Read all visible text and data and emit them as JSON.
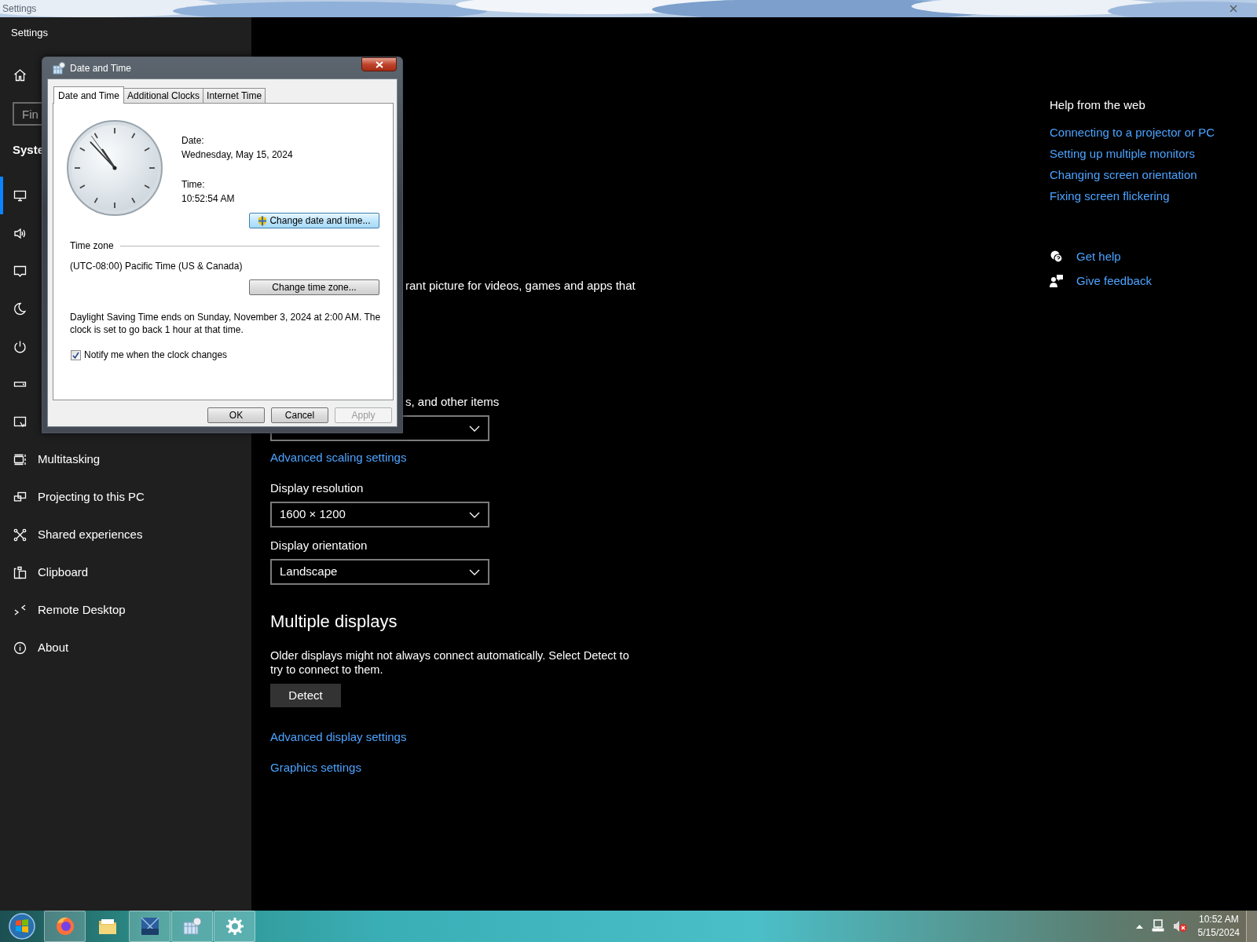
{
  "background_window": {
    "title": "Settings"
  },
  "settings": {
    "title": "Settings",
    "search": {
      "placeholder": "Fin"
    },
    "section": "Syste",
    "nav": [
      {
        "selected": true
      },
      {
        "selected": false
      },
      {
        "selected": false
      },
      {
        "selected": false
      },
      {
        "selected": false
      },
      {
        "selected": false
      },
      {
        "selected": false
      },
      {
        "label": "Multitasking",
        "selected": false
      },
      {
        "label": "Projecting to this PC",
        "selected": false
      },
      {
        "label": "Shared experiences",
        "selected": false
      },
      {
        "label": "Clipboard",
        "selected": false
      },
      {
        "label": "Remote Desktop",
        "selected": false
      },
      {
        "label": "About",
        "selected": false
      }
    ],
    "main": [
      {
        "kind": "fragment",
        "text": "rant picture for videos, games and apps that"
      },
      {
        "kind": "fragment",
        "text": "s, and other items"
      },
      {
        "kind": "dropdown"
      },
      {
        "kind": "link",
        "text": "Advanced scaling settings"
      },
      {
        "kind": "label",
        "text": "Display resolution"
      },
      {
        "kind": "dropdown",
        "value": "1600 × 1200"
      },
      {
        "kind": "label",
        "text": "Display orientation"
      },
      {
        "kind": "dropdown",
        "value": "Landscape"
      },
      {
        "kind": "heading",
        "text": "Multiple displays"
      },
      {
        "kind": "paragraph",
        "text": "Older displays might not always connect automatically. Select Detect to try to connect to them."
      },
      {
        "kind": "button",
        "text": "Detect"
      },
      {
        "kind": "link",
        "text": "Advanced display settings"
      },
      {
        "kind": "link",
        "text": "Graphics settings"
      }
    ],
    "help": {
      "title": "Help from the web",
      "links": [
        "Connecting to a projector or PC",
        "Setting up multiple monitors",
        "Changing screen orientation",
        "Fixing screen flickering"
      ],
      "actions": [
        {
          "label": "Get help"
        },
        {
          "label": "Give feedback"
        }
      ]
    }
  },
  "dialog": {
    "title": "Date and Time",
    "tabs": [
      {
        "label": "Date and Time",
        "selected": true
      },
      {
        "label": "Additional Clocks",
        "selected": false
      },
      {
        "label": "Internet Time",
        "selected": false
      }
    ],
    "date_label": "Date:",
    "date": "Wednesday, May 15, 2024",
    "time_label": "Time:",
    "time": "10:52:54 AM",
    "change_button": {
      "label": "Change date and time...",
      "highlighted": true
    },
    "time_zone_heading": "Time zone",
    "time_zone": "(UTC-08:00) Pacific Time (US & Canada)",
    "change_zone_button": {
      "label": "Change time zone...",
      "highlighted": false
    },
    "dst_note": "Daylight Saving Time ends on Sunday, November 3, 2024 at 2:00 AM. The clock is set to go back 1 hour at that time.",
    "notify": {
      "label": "Notify me when the clock changes",
      "checked": true
    },
    "buttons": [
      {
        "label": "OK",
        "disabled": false
      },
      {
        "label": "Cancel",
        "disabled": false
      },
      {
        "label": "Apply",
        "disabled": true
      }
    ]
  },
  "taskbar": {
    "apps": [
      {
        "running": true
      },
      {
        "running": false
      },
      {
        "running": true
      },
      {
        "running": true
      },
      {
        "running": true
      }
    ],
    "time": "10:52 AM",
    "date": "5/15/2024"
  }
}
